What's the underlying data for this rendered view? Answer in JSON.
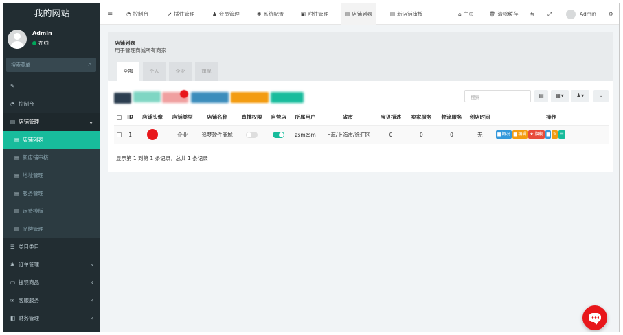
{
  "sidebar": {
    "logo": "我的网站",
    "user_name": "Admin",
    "user_status": "在线",
    "search_placeholder": "搜索菜单",
    "items": [
      {
        "icon": "pencil-icon",
        "glyph": "✎",
        "label": ""
      },
      {
        "icon": "dashboard-icon",
        "glyph": "◔",
        "label": "控制台"
      },
      {
        "icon": "list-icon",
        "glyph": "▤",
        "label": "店铺管理",
        "chev": "⌄"
      },
      {
        "icon": "list-icon",
        "glyph": "▤",
        "label": "店铺列表"
      },
      {
        "icon": "list-icon",
        "glyph": "▤",
        "label": "新店铺审核"
      },
      {
        "icon": "list-icon",
        "glyph": "▤",
        "label": "地址管理"
      },
      {
        "icon": "list-icon",
        "glyph": "▤",
        "label": "服务管理"
      },
      {
        "icon": "list-icon",
        "glyph": "▤",
        "label": "运费模版"
      },
      {
        "icon": "list-icon",
        "glyph": "▤",
        "label": "品牌管理"
      },
      {
        "icon": "bars-icon",
        "glyph": "☰",
        "label": "类目类目"
      },
      {
        "icon": "cog-icon",
        "glyph": "✱",
        "label": "订单管理",
        "chev": "‹"
      },
      {
        "icon": "monitor-icon",
        "glyph": "▭",
        "label": "提现商品",
        "chev": "‹"
      },
      {
        "icon": "comments-icon",
        "glyph": "✉",
        "label": "客服服务",
        "chev": "‹"
      },
      {
        "icon": "wallet-icon",
        "glyph": "◧",
        "label": "财务管理",
        "chev": "‹"
      }
    ]
  },
  "topbar": {
    "menu_glyph": "≡",
    "tabs": [
      {
        "icon": "dashboard-icon",
        "glyph": "◔",
        "label": "控制台"
      },
      {
        "icon": "rocket-icon",
        "glyph": "➚",
        "label": "插件管理"
      },
      {
        "icon": "user-icon",
        "glyph": "♟",
        "label": "会员管理"
      },
      {
        "icon": "cog-icon",
        "glyph": "✱",
        "label": "系统配置"
      },
      {
        "icon": "image-icon",
        "glyph": "▣",
        "label": "附件管理"
      },
      {
        "icon": "list-icon",
        "glyph": "▤",
        "label": "店铺列表"
      },
      {
        "icon": "list-icon",
        "glyph": "▤",
        "label": "新店铺审核"
      }
    ],
    "home_label": "主页",
    "clear_cache_label": "清除缓存",
    "admin_label": "Admin"
  },
  "page": {
    "title": "店铺列表",
    "subtitle": "用于管理商城所有商家",
    "tabs": [
      "全部",
      "个人",
      "企业",
      "旗舰"
    ]
  },
  "toolbar": {
    "search_placeholder": "搜索"
  },
  "table": {
    "headers": [
      "ID",
      "店铺头像",
      "店铺类型",
      "店铺名称",
      "直播权限",
      "自营店",
      "所属用户",
      "省市",
      "宝贝描述",
      "卖家服务",
      "物流服务",
      "创店时间",
      "操作"
    ],
    "rows": [
      {
        "id": "1",
        "type": "企业",
        "name": "追梦软件商城",
        "live": false,
        "self_run": true,
        "user": "zsmzsm",
        "region": "上海/上海市/徐汇区",
        "desc": "0",
        "service": "0",
        "logistics": "0",
        "created": "无",
        "ops": [
          "概况",
          "编辑",
          "旗舰"
        ]
      }
    ]
  },
  "pager": {
    "summary": "显示第 1 到第 1 条记录，总共 1 条记录"
  },
  "colors": {
    "accent": "#18bc9c",
    "sidebar_bg": "#222d32",
    "chat": "#e8171b"
  }
}
